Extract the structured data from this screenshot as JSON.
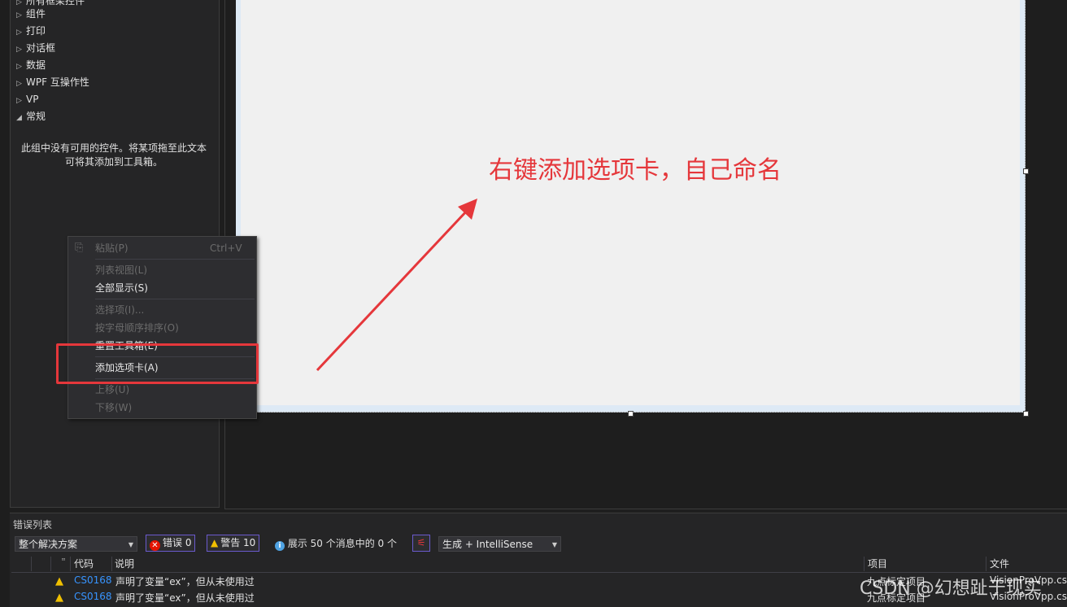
{
  "toolbox": {
    "items": [
      {
        "label": "所有框架控件",
        "expanded": false
      },
      {
        "label": "组件",
        "expanded": false
      },
      {
        "label": "打印",
        "expanded": false
      },
      {
        "label": "对话框",
        "expanded": false
      },
      {
        "label": "数据",
        "expanded": false
      },
      {
        "label": "WPF 互操作性",
        "expanded": false
      },
      {
        "label": "VP",
        "expanded": false
      },
      {
        "label": "常规",
        "expanded": true
      }
    ],
    "empty_text_line1": "此组中没有可用的控件。将某项拖至此文本",
    "empty_text_line2": "可将其添加到工具箱。"
  },
  "annotation": {
    "text": "右键添加选项卡，自己命名",
    "color": "#e5373b"
  },
  "context_menu": {
    "paste": "粘贴(P)",
    "paste_shortcut": "Ctrl+V",
    "list_view": "列表视图(L)",
    "show_all": "全部显示(S)",
    "choose_items": "选择项(I)...",
    "sort_alpha": "按字母顺序排序(O)",
    "reset_toolbox": "重置工具箱(E)",
    "add_tab": "添加选项卡(A)",
    "move_up": "上移(U)",
    "move_down": "下移(W)"
  },
  "error_list": {
    "title": "错误列表",
    "scope": "整个解决方案",
    "errors_label": "错误 0",
    "warnings_label": "警告 10",
    "messages_label": "展示 50 个消息中的 0 个",
    "build_filter": "生成 + IntelliSense",
    "columns": {
      "code": "代码",
      "description": "说明",
      "project": "项目",
      "file": "文件"
    },
    "rows": [
      {
        "code": "CS0168",
        "description": "声明了变量“ex”，但从未使用过",
        "project": "九点标定项目",
        "file": "VisionProVpp.cs"
      },
      {
        "code": "CS0168",
        "description": "声明了变量“ex”，但从未使用过",
        "project": "九点标定项目",
        "file": "VisionProVpp.cs"
      }
    ]
  },
  "watermark": "CSDN @幻想趾于现实"
}
